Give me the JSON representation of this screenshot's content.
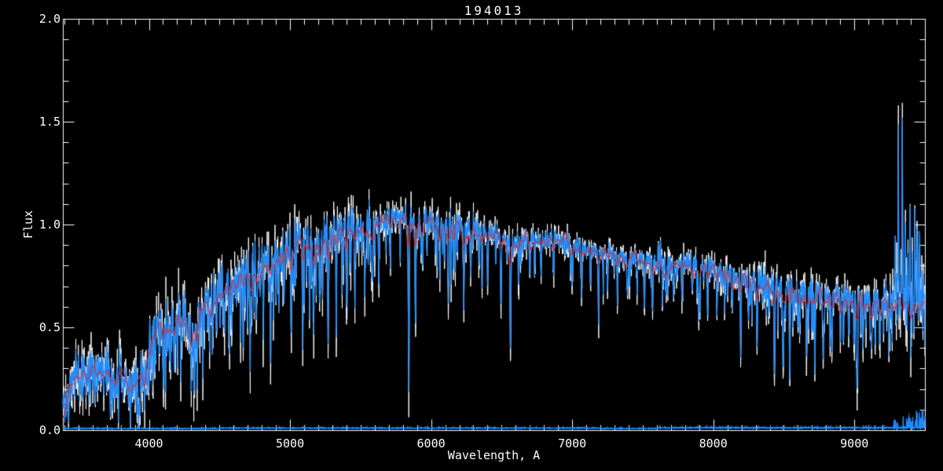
{
  "window": {
    "title": "194013",
    "background": "#000000"
  },
  "labels": {
    "plot_title": "194013",
    "x_axis": "Wavelength, A",
    "y_axis": "Flux"
  },
  "chart_data": {
    "type": "line",
    "title": "194013",
    "xlabel": "Wavelength, A",
    "ylabel": "Flux",
    "xlim": [
      3390,
      9500
    ],
    "ylim": [
      0.0,
      2.0
    ],
    "x_major_ticks": [
      4000,
      5000,
      6000,
      7000,
      8000,
      9000
    ],
    "x_minor_step": 100,
    "y_major_ticks": [
      0.0,
      0.5,
      1.0,
      1.5,
      2.0
    ],
    "y_minor_step": 0.1,
    "grid": false,
    "legend": "none",
    "colors": {
      "axis": "#ffffff",
      "raw": "#ffffff",
      "spectrum": "#1e8cff",
      "model": "#e02830"
    },
    "series": [
      {
        "name": "raw-spectrum",
        "color": "#ffffff",
        "style": "noisy"
      },
      {
        "name": "observed-spectrum",
        "color": "#1e8cff",
        "style": "noisy"
      },
      {
        "name": "model-fit",
        "color": "#e02830",
        "style": "smooth"
      },
      {
        "name": "error-spectrum",
        "color": "#1e8cff",
        "style": "baseline-near-zero"
      }
    ],
    "continuum_points": [
      [
        3390,
        0.08
      ],
      [
        3420,
        0.16
      ],
      [
        3450,
        0.23
      ],
      [
        3490,
        0.28
      ],
      [
        3530,
        0.3
      ],
      [
        3560,
        0.25
      ],
      [
        3600,
        0.31
      ],
      [
        3640,
        0.27
      ],
      [
        3680,
        0.33
      ],
      [
        3720,
        0.29
      ],
      [
        3760,
        0.24
      ],
      [
        3800,
        0.31
      ],
      [
        3840,
        0.25
      ],
      [
        3880,
        0.21
      ],
      [
        3915,
        0.24
      ],
      [
        3940,
        0.33
      ],
      [
        3970,
        0.28
      ],
      [
        4000,
        0.42
      ],
      [
        4040,
        0.5
      ],
      [
        4070,
        0.53
      ],
      [
        4100,
        0.47
      ],
      [
        4140,
        0.55
      ],
      [
        4180,
        0.52
      ],
      [
        4220,
        0.57
      ],
      [
        4260,
        0.54
      ],
      [
        4300,
        0.47
      ],
      [
        4340,
        0.52
      ],
      [
        4390,
        0.62
      ],
      [
        4440,
        0.61
      ],
      [
        4490,
        0.68
      ],
      [
        4540,
        0.72
      ],
      [
        4580,
        0.69
      ],
      [
        4630,
        0.76
      ],
      [
        4680,
        0.8
      ],
      [
        4730,
        0.82
      ],
      [
        4770,
        0.78
      ],
      [
        4820,
        0.83
      ],
      [
        4870,
        0.8
      ],
      [
        4910,
        0.86
      ],
      [
        4960,
        0.88
      ],
      [
        5010,
        0.9
      ],
      [
        5060,
        0.93
      ],
      [
        5110,
        0.95
      ],
      [
        5170,
        0.89
      ],
      [
        5240,
        0.95
      ],
      [
        5310,
        0.97
      ],
      [
        5390,
        0.98
      ],
      [
        5470,
        1.0
      ],
      [
        5550,
        1.01
      ],
      [
        5630,
        1.02
      ],
      [
        5710,
        1.03
      ],
      [
        5800,
        1.04
      ],
      [
        5890,
        0.99
      ],
      [
        5960,
        1.03
      ],
      [
        6060,
        1.02
      ],
      [
        6160,
        1.0
      ],
      [
        6260,
        0.98
      ],
      [
        6360,
        0.97
      ],
      [
        6460,
        0.95
      ],
      [
        6560,
        0.91
      ],
      [
        6660,
        0.93
      ],
      [
        6760,
        0.92
      ],
      [
        6870,
        0.93
      ],
      [
        6960,
        0.91
      ],
      [
        7060,
        0.89
      ],
      [
        7160,
        0.87
      ],
      [
        7260,
        0.86
      ],
      [
        7360,
        0.85
      ],
      [
        7460,
        0.84
      ],
      [
        7560,
        0.83
      ],
      [
        7620,
        0.795
      ],
      [
        7700,
        0.8
      ],
      [
        7800,
        0.81
      ],
      [
        7900,
        0.8
      ],
      [
        8000,
        0.78
      ],
      [
        8100,
        0.76
      ],
      [
        8200,
        0.74
      ],
      [
        8300,
        0.72
      ],
      [
        8400,
        0.71
      ],
      [
        8500,
        0.69
      ],
      [
        8600,
        0.68
      ],
      [
        8700,
        0.67
      ],
      [
        8800,
        0.66
      ],
      [
        8900,
        0.65
      ],
      [
        9000,
        0.64
      ],
      [
        9100,
        0.63
      ],
      [
        9200,
        0.625
      ],
      [
        9300,
        0.62
      ],
      [
        9400,
        0.62
      ],
      [
        9500,
        0.62
      ]
    ],
    "absorption_lines": [
      [
        3727,
        0.1
      ],
      [
        3770,
        0.12
      ],
      [
        3820,
        0.1
      ],
      [
        3869,
        0.12
      ],
      [
        3933,
        0.15
      ],
      [
        3968,
        0.13
      ],
      [
        4045,
        0.18
      ],
      [
        4101,
        0.24
      ],
      [
        4144,
        0.16
      ],
      [
        4226,
        0.22
      ],
      [
        4300,
        0.2
      ],
      [
        4340,
        0.22
      ],
      [
        4383,
        0.24
      ],
      [
        4430,
        0.16
      ],
      [
        4481,
        0.2
      ],
      [
        4530,
        0.22
      ],
      [
        4571,
        0.26
      ],
      [
        4620,
        0.18
      ],
      [
        4668,
        0.22
      ],
      [
        4720,
        0.26
      ],
      [
        4762,
        0.2
      ],
      [
        4861,
        0.32
      ],
      [
        4920,
        0.24
      ],
      [
        4957,
        0.3
      ],
      [
        5010,
        0.24
      ],
      [
        5090,
        0.52
      ],
      [
        5168,
        0.32
      ],
      [
        5210,
        0.24
      ],
      [
        5270,
        0.32
      ],
      [
        5328,
        0.26
      ],
      [
        5400,
        0.32
      ],
      [
        5460,
        0.26
      ],
      [
        5530,
        0.32
      ],
      [
        5586,
        0.24
      ],
      [
        5630,
        0.26
      ],
      [
        5712,
        0.24
      ],
      [
        5841,
        0.7
      ],
      [
        5890,
        0.48
      ],
      [
        5940,
        0.24
      ],
      [
        6062,
        0.32
      ],
      [
        6122,
        0.38
      ],
      [
        6160,
        0.24
      ],
      [
        6230,
        0.3
      ],
      [
        6280,
        0.24
      ],
      [
        6360,
        0.22
      ],
      [
        6400,
        0.24
      ],
      [
        6495,
        0.3
      ],
      [
        6563,
        0.52
      ],
      [
        6620,
        0.2
      ],
      [
        6700,
        0.16
      ],
      [
        6780,
        0.18
      ],
      [
        6867,
        0.2
      ],
      [
        7000,
        0.18
      ],
      [
        7065,
        0.16
      ],
      [
        7130,
        0.18
      ],
      [
        7186,
        0.2
      ],
      [
        7250,
        0.16
      ],
      [
        7320,
        0.18
      ],
      [
        7390,
        0.16
      ],
      [
        7460,
        0.18
      ],
      [
        7512,
        0.16
      ],
      [
        7570,
        0.18
      ],
      [
        7665,
        0.16
      ],
      [
        7720,
        0.18
      ],
      [
        7780,
        0.2
      ],
      [
        7850,
        0.16
      ],
      [
        7900,
        0.18
      ],
      [
        7960,
        0.2
      ],
      [
        8025,
        0.18
      ],
      [
        8080,
        0.16
      ],
      [
        8134,
        0.2
      ],
      [
        8195,
        0.38
      ],
      [
        8250,
        0.18
      ],
      [
        8310,
        0.32
      ],
      [
        8434,
        0.42
      ],
      [
        8498,
        0.28
      ],
      [
        8542,
        0.44
      ],
      [
        8600,
        0.2
      ],
      [
        8662,
        0.38
      ],
      [
        8720,
        0.2
      ],
      [
        8780,
        0.28
      ],
      [
        8840,
        0.32
      ],
      [
        8900,
        0.22
      ],
      [
        8960,
        0.2
      ],
      [
        9020,
        0.38
      ],
      [
        9061,
        0.22
      ],
      [
        9120,
        0.28
      ],
      [
        9180,
        0.2
      ],
      [
        9245,
        0.24
      ],
      [
        9340,
        0.22
      ],
      [
        9400,
        0.2
      ]
    ],
    "emission_lines": [
      [
        6301,
        0.05
      ],
      [
        6880,
        0.05
      ],
      [
        7610,
        0.09
      ],
      [
        7625,
        0.13
      ],
      [
        8344,
        0.08
      ],
      [
        8430,
        0.05
      ],
      [
        9290,
        0.33
      ],
      [
        9312,
        0.83
      ],
      [
        9340,
        1.04
      ],
      [
        9360,
        0.45
      ],
      [
        9378,
        0.22
      ],
      [
        9395,
        0.62
      ],
      [
        9412,
        0.28
      ],
      [
        9428,
        0.52
      ],
      [
        9445,
        0.33
      ],
      [
        9462,
        0.42
      ]
    ],
    "noise_profile": [
      [
        3390,
        3600,
        0.05
      ],
      [
        3600,
        3900,
        0.055
      ],
      [
        3900,
        4400,
        0.065
      ],
      [
        4400,
        5000,
        0.06
      ],
      [
        5000,
        5600,
        0.05
      ],
      [
        5600,
        6200,
        0.035
      ],
      [
        6200,
        6900,
        0.028
      ],
      [
        6900,
        7600,
        0.028
      ],
      [
        7600,
        8300,
        0.032
      ],
      [
        8300,
        8900,
        0.04
      ],
      [
        8900,
        9250,
        0.045
      ],
      [
        9250,
        9500,
        0.085
      ]
    ],
    "forest_profile": [
      [
        3390,
        3900,
        0.1,
        0.18
      ],
      [
        3900,
        4600,
        0.13,
        0.28
      ],
      [
        4600,
        5600,
        0.11,
        0.3
      ],
      [
        5600,
        6400,
        0.05,
        0.25
      ],
      [
        6400,
        7500,
        0.04,
        0.18
      ],
      [
        7500,
        8400,
        0.05,
        0.2
      ],
      [
        8400,
        9250,
        0.07,
        0.25
      ],
      [
        9250,
        9500,
        0.08,
        0.25
      ]
    ],
    "error_spectrum_level": 0.006,
    "seed": 194013
  }
}
